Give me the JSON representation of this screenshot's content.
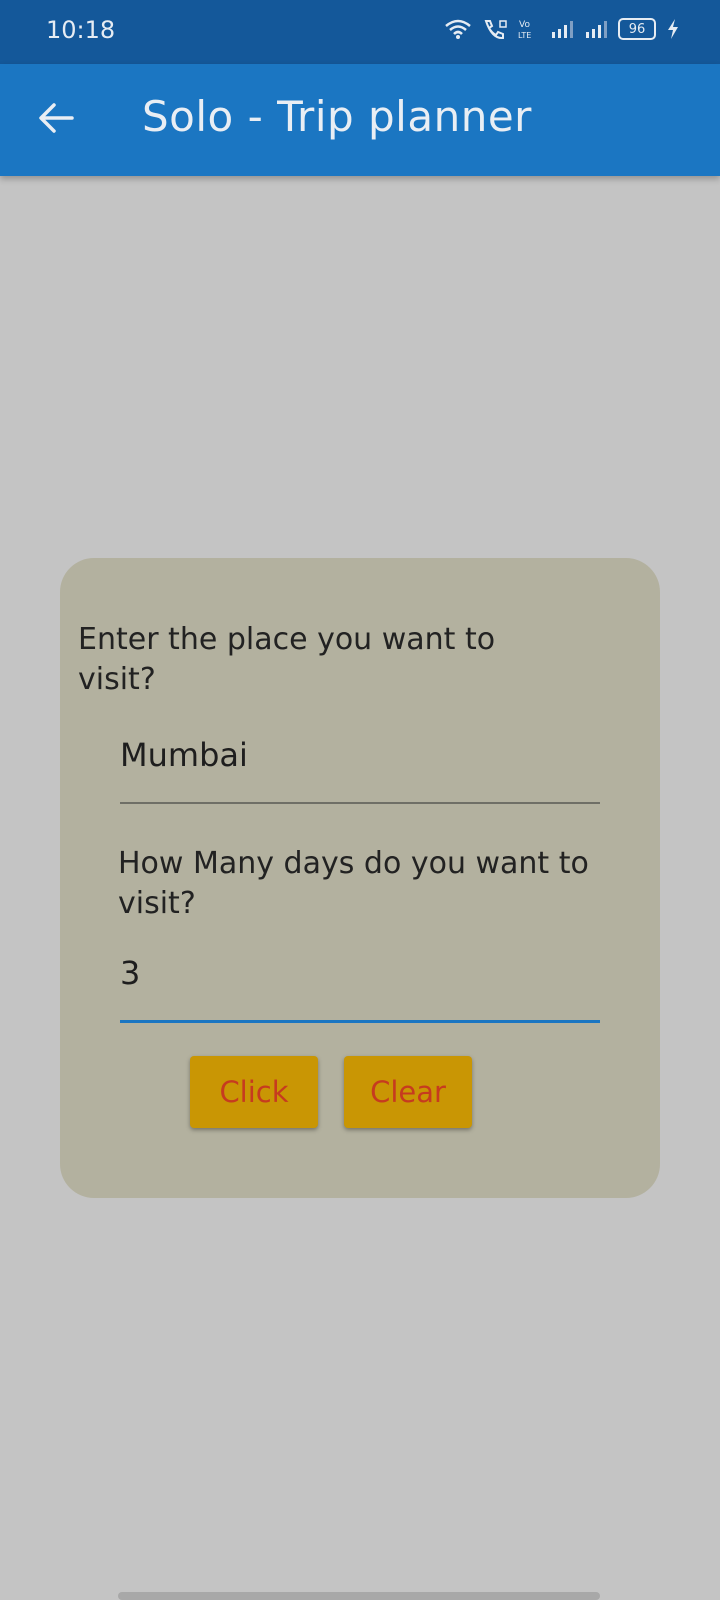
{
  "status": {
    "time": "10:18",
    "battery": "96"
  },
  "app_bar": {
    "title": "Solo - Trip planner",
    "back_icon": "arrow-left-icon"
  },
  "form": {
    "place_label": "Enter the place you want to visit?",
    "place_value": "Mumbai",
    "days_label": "How Many days do you want to visit?",
    "days_value": "3",
    "click_label": "Click",
    "clear_label": "Clear"
  },
  "colors": {
    "status_bar": "#14589a",
    "app_bar": "#1b76c2",
    "dialog": "#b3b19f",
    "button_bg": "#c99604",
    "button_text": "#c63b1f",
    "accent": "#1b76c2"
  }
}
